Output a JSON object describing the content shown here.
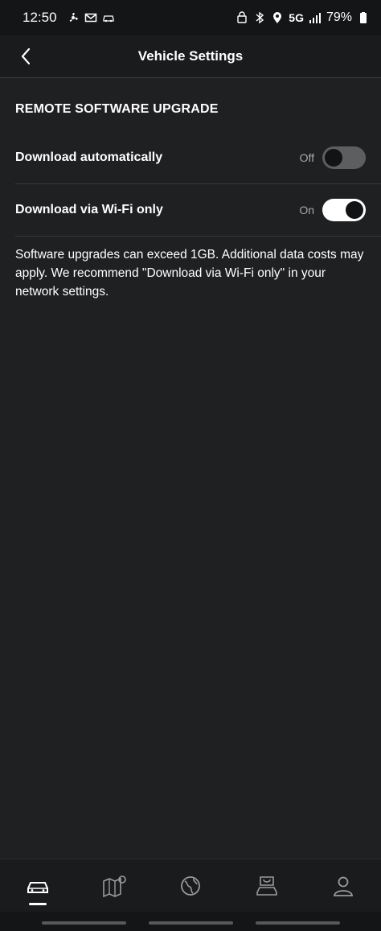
{
  "status_bar": {
    "time": "12:50",
    "network": "5G",
    "battery": "79%",
    "icons_left": [
      "fan-icon",
      "mail-icon",
      "car-icon"
    ],
    "icons_right": [
      "nfc-lock-icon",
      "bluetooth-icon",
      "location-icon",
      "signal-icon",
      "battery-icon"
    ]
  },
  "header": {
    "title": "Vehicle Settings",
    "back_icon": "chevron-left-icon"
  },
  "section": {
    "title": "REMOTE SOFTWARE UPGRADE"
  },
  "settings": [
    {
      "label": "Download automatically",
      "state_label": "Off",
      "enabled": false
    },
    {
      "label": "Download via Wi-Fi only",
      "state_label": "On",
      "enabled": true
    }
  ],
  "note": "Software upgrades can exceed 1GB. Additional data costs may apply. We recommend \"Download via Wi-Fi only\" in your network settings.",
  "bottom_nav": {
    "items": [
      {
        "icon": "car-icon",
        "active": true
      },
      {
        "icon": "map-pin-icon",
        "active": false
      },
      {
        "icon": "globe-icon",
        "active": false
      },
      {
        "icon": "shop-icon",
        "active": false
      },
      {
        "icon": "profile-icon",
        "active": false
      }
    ]
  },
  "colors": {
    "background": "#1f2022",
    "text": "#ffffff",
    "muted": "#a7a8aa",
    "toggle_off": "#5d5e60",
    "toggle_on": "#ffffff"
  }
}
